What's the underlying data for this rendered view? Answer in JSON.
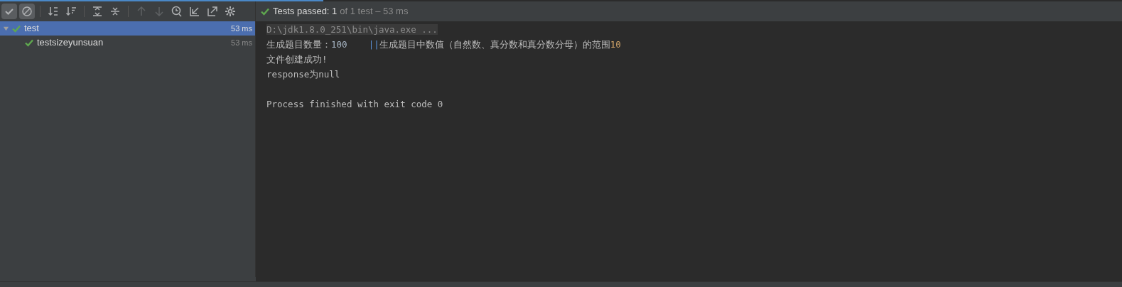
{
  "toolbar": [
    {
      "kind": "check",
      "selected": true,
      "disabled": false
    },
    {
      "kind": "cancel",
      "selected": true,
      "disabled": false
    },
    {
      "kind": "sep"
    },
    {
      "kind": "sort-alpha",
      "selected": false,
      "disabled": false
    },
    {
      "kind": "sort-duration",
      "selected": false,
      "disabled": false
    },
    {
      "kind": "sep"
    },
    {
      "kind": "expand",
      "selected": false,
      "disabled": false
    },
    {
      "kind": "collapse",
      "selected": false,
      "disabled": false
    },
    {
      "kind": "sep"
    },
    {
      "kind": "up",
      "selected": false,
      "disabled": true
    },
    {
      "kind": "down",
      "selected": false,
      "disabled": true
    },
    {
      "kind": "history",
      "selected": false,
      "disabled": false
    },
    {
      "kind": "import",
      "selected": false,
      "disabled": false
    },
    {
      "kind": "export",
      "selected": false,
      "disabled": false
    },
    {
      "kind": "settings",
      "selected": false,
      "disabled": false
    }
  ],
  "status": {
    "passed": "Tests passed: 1",
    "detail": "of 1 test – 53 ms"
  },
  "tree": [
    {
      "name": "test",
      "time": "53 ms",
      "selected": true,
      "expanded": true,
      "children": [
        {
          "name": "testsizeyunsuan",
          "time": "53 ms",
          "selected": false
        }
      ]
    }
  ],
  "console": [
    {
      "kind": "output",
      "segments": [
        {
          "text": "D:\\jdk1.8.0_251\\bin\\java.exe ...",
          "kind": "command"
        }
      ]
    },
    {
      "kind": "output",
      "segments": [
        {
          "text": "生成题目数量：",
          "kind": "plain"
        },
        {
          "text": "100    ",
          "kind": "number"
        },
        {
          "text": "||",
          "kind": "link"
        },
        {
          "text": "生成题目中数值（自然数、真分数和真分数分母）的范围",
          "kind": "plain"
        },
        {
          "text": "10",
          "kind": "accent"
        }
      ]
    },
    {
      "kind": "output",
      "segments": [
        {
          "text": "文件创建成功!",
          "kind": "plain"
        }
      ]
    },
    {
      "kind": "output",
      "segments": [
        {
          "text": "response为null",
          "kind": "plain"
        }
      ]
    },
    {
      "kind": "blank"
    },
    {
      "kind": "output",
      "segments": [
        {
          "text": "Process finished with exit code 0",
          "kind": "plain"
        }
      ]
    }
  ]
}
